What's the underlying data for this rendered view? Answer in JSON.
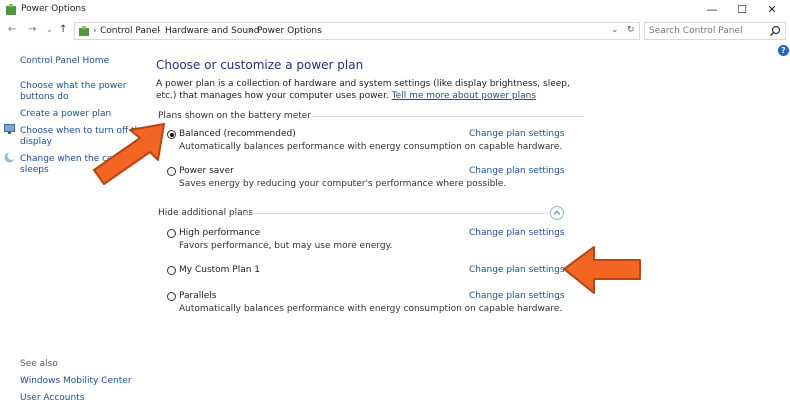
{
  "window": {
    "title": "Power Options",
    "controls": {
      "minimize": "—",
      "maximize": "☐",
      "close": "✕"
    }
  },
  "address": {
    "breadcrumbs": [
      "Control Panel",
      "Hardware and Sound",
      "Power Options"
    ],
    "search_placeholder": "Search Control Panel"
  },
  "sidebar": {
    "home": "Control Panel Home",
    "items": [
      {
        "label": "Choose what the power buttons do",
        "line1": "Choose what the power",
        "line2": "buttons do"
      },
      {
        "label": "Create a power plan"
      },
      {
        "label": "Choose when to turn off the display",
        "line1": "Choose when to turn off the",
        "line2": "display"
      },
      {
        "label": "Change when the computer sleeps",
        "line1": "Change when the co",
        "line2": "sleeps"
      }
    ],
    "see_also": "See also",
    "see_also_links": [
      "Windows Mobility Center",
      "User Accounts"
    ]
  },
  "main": {
    "heading": "Choose or customize a power plan",
    "intro": "A power plan is a collection of hardware and system settings (like display brightness, sleep, etc.) that manages how your computer uses power.",
    "intro_link": "Tell me more about power plans",
    "section_shown": "Plans shown on the battery meter",
    "section_hidden": "Hide additional plans",
    "change_label": "Change plan settings",
    "plans": [
      {
        "name": "Balanced (recommended)",
        "desc": "Automatically balances performance with energy consumption on capable hardware.",
        "selected": true
      },
      {
        "name": "Power saver",
        "desc": "Saves energy by reducing your computer's performance where possible.",
        "selected": false
      },
      {
        "name": "High performance",
        "desc": "Favors performance, but may use more energy.",
        "selected": false
      },
      {
        "name": "My Custom Plan 1",
        "desc": "",
        "selected": false
      },
      {
        "name": "Parallels",
        "desc": "Automatically balances performance with energy consumption on capable hardware.",
        "selected": false
      }
    ]
  },
  "colors": {
    "link": "#1a4e9e",
    "heading": "#1e3287",
    "arrow": "#f26522"
  }
}
